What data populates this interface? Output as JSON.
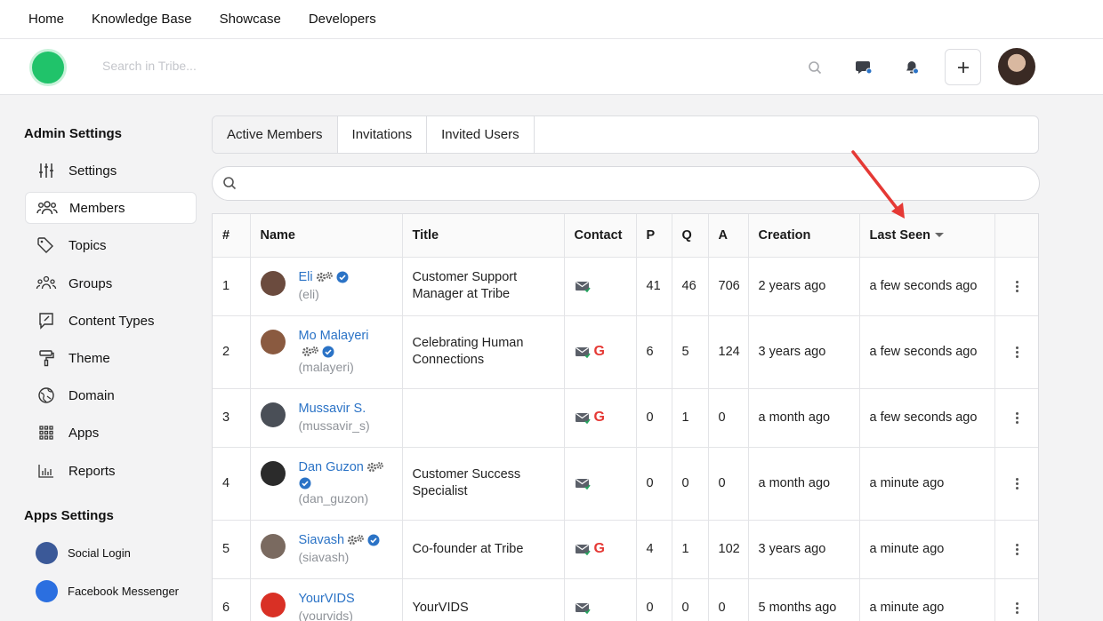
{
  "topnav": {
    "items": [
      "Home",
      "Knowledge Base",
      "Showcase",
      "Developers"
    ]
  },
  "header": {
    "search_placeholder": "Search in Tribe..."
  },
  "sidebar": {
    "admin_title": "Admin Settings",
    "items": [
      {
        "label": "Settings",
        "icon": "sliders-icon"
      },
      {
        "label": "Members",
        "icon": "users-icon"
      },
      {
        "label": "Topics",
        "icon": "tag-icon"
      },
      {
        "label": "Groups",
        "icon": "groups-icon"
      },
      {
        "label": "Content Types",
        "icon": "chat-edit-icon"
      },
      {
        "label": "Theme",
        "icon": "paint-roller-icon"
      },
      {
        "label": "Domain",
        "icon": "globe-icon"
      },
      {
        "label": "Apps",
        "icon": "grid-icon"
      },
      {
        "label": "Reports",
        "icon": "bar-chart-icon"
      }
    ],
    "apps_title": "Apps Settings",
    "apps": [
      {
        "label": "Social Login",
        "color": "#3b5998"
      },
      {
        "label": "Facebook Messenger",
        "color": "#2b6fe0"
      }
    ]
  },
  "tabs": [
    "Active Members",
    "Invitations",
    "Invited Users"
  ],
  "table": {
    "headers": [
      "#",
      "Name",
      "Title",
      "Contact",
      "P",
      "Q",
      "A",
      "Creation",
      "Last Seen"
    ],
    "rows": [
      {
        "num": "1",
        "name": "Eli",
        "handle": "(eli)",
        "title": "Customer Support Manager at Tribe",
        "google": false,
        "p": "41",
        "q": "46",
        "a": "706",
        "creation": "2 years ago",
        "last_seen": "a few seconds ago",
        "avatar": "#6b4b3e"
      },
      {
        "num": "2",
        "name": "Mo Malayeri",
        "handle": "(malayeri)",
        "title": "Celebrating Human Connections",
        "google": true,
        "p": "6",
        "q": "5",
        "a": "124",
        "creation": "3 years ago",
        "last_seen": "a few seconds ago",
        "avatar": "#8a5a40"
      },
      {
        "num": "3",
        "name": "Mussavir S.",
        "handle": "(mussavir_s)",
        "title": "",
        "google": true,
        "p": "0",
        "q": "1",
        "a": "0",
        "creation": "a month ago",
        "last_seen": "a few seconds ago",
        "avatar": "#4a4f57"
      },
      {
        "num": "4",
        "name": "Dan Guzon",
        "handle": "(dan_guzon)",
        "title": "Customer Success Specialist",
        "google": false,
        "p": "0",
        "q": "0",
        "a": "0",
        "creation": "a month ago",
        "last_seen": "a minute ago",
        "avatar": "#2b2b2b"
      },
      {
        "num": "5",
        "name": "Siavash",
        "handle": "(siavash)",
        "title": "Co-founder at Tribe",
        "google": true,
        "p": "4",
        "q": "1",
        "a": "102",
        "creation": "3 years ago",
        "last_seen": "a minute ago",
        "avatar": "#7a6a60"
      },
      {
        "num": "6",
        "name": "YourVIDS",
        "handle": "(yourvids)",
        "title": "YourVIDS",
        "google": false,
        "p": "0",
        "q": "0",
        "a": "0",
        "creation": "5 months ago",
        "last_seen": "a minute ago",
        "avatar": "#d93025"
      }
    ]
  },
  "colors": {
    "accent": "#2b73c6",
    "logo": "#20c36a",
    "arrow": "#e53935"
  }
}
